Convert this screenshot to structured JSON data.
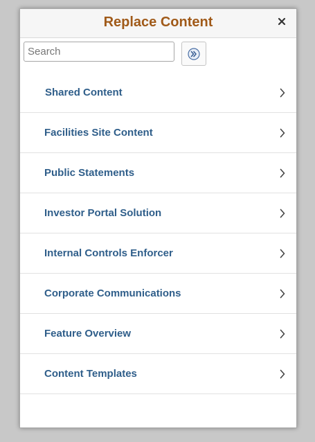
{
  "dialog": {
    "title": "Replace Content",
    "close_label": "×"
  },
  "search": {
    "placeholder": "Search",
    "value": ""
  },
  "items": [
    {
      "label": "Shared Content"
    },
    {
      "label": "Facilities Site Content"
    },
    {
      "label": "Public Statements"
    },
    {
      "label": "Investor Portal Solution"
    },
    {
      "label": "Internal Controls Enforcer"
    },
    {
      "label": "Corporate Communications"
    },
    {
      "label": "Feature Overview"
    },
    {
      "label": "Content Templates"
    }
  ],
  "colors": {
    "title": "#a05a19",
    "item_text": "#2f5e8a",
    "backdrop": "#c8c8c8"
  },
  "icons": {
    "close": "close-icon",
    "search_go": "double-chevron-right-icon",
    "item_arrow": "chevron-right-icon"
  }
}
